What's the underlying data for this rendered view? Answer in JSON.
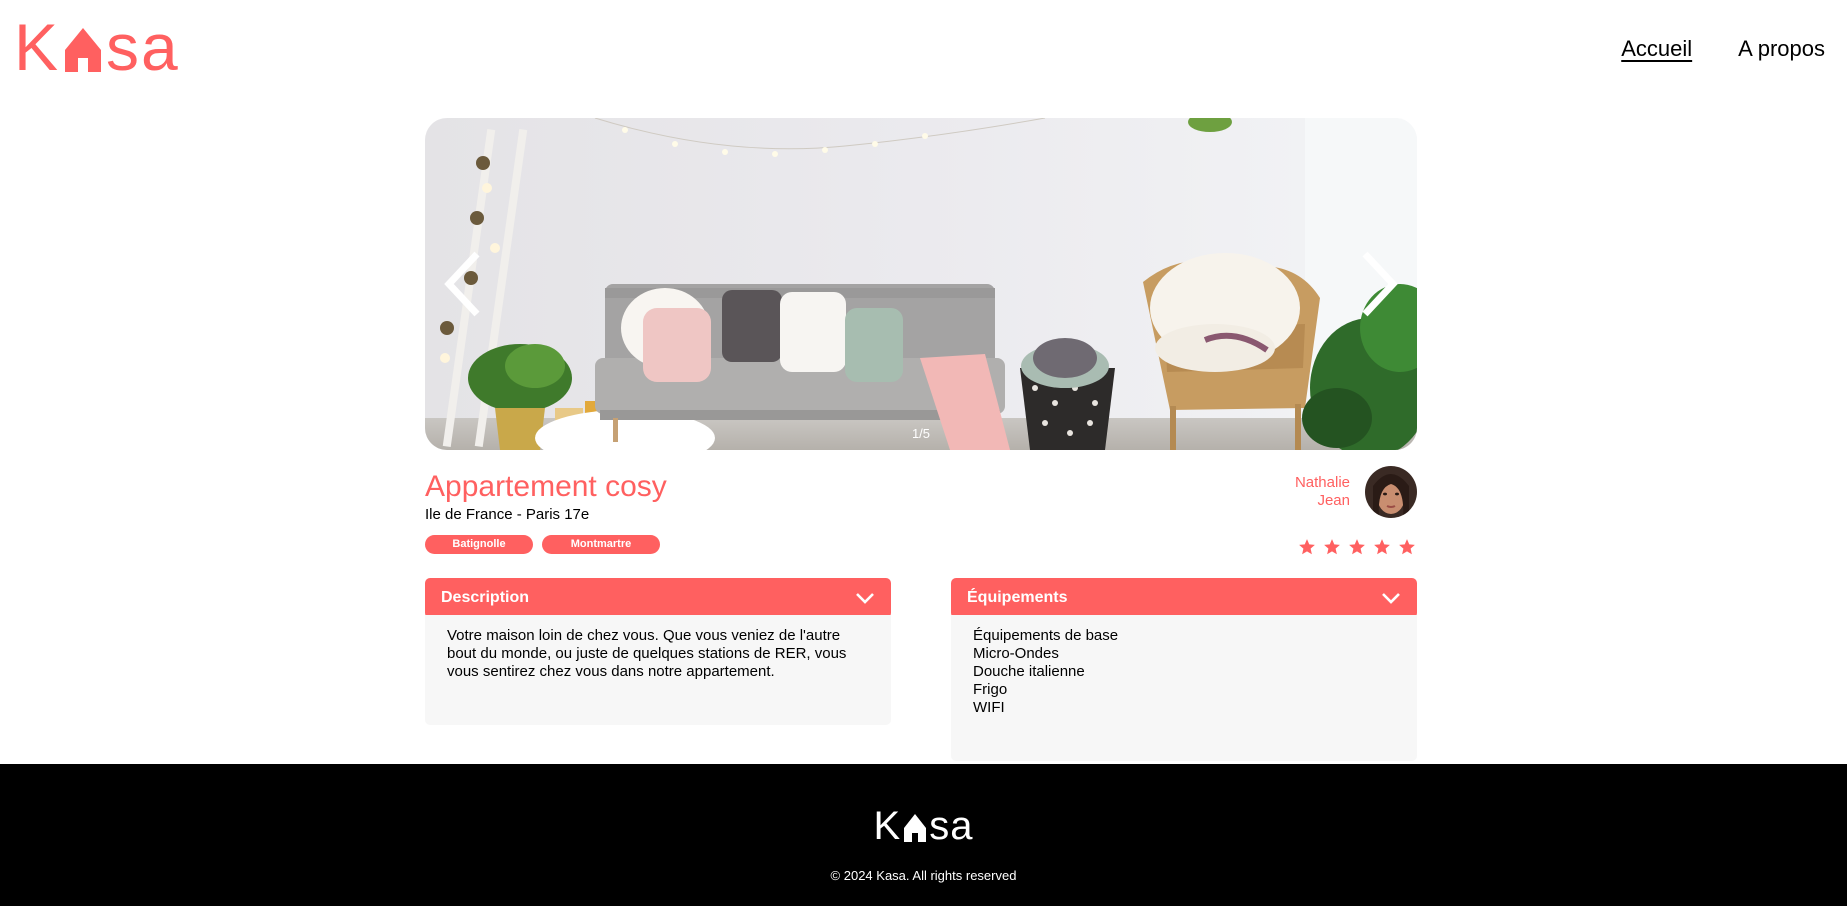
{
  "header": {
    "logo_letters": [
      "K",
      "sa"
    ],
    "logo_text": "Kasa",
    "nav": [
      {
        "label": "Accueil",
        "active": true
      },
      {
        "label": "A propos",
        "active": false
      }
    ]
  },
  "carousel": {
    "counter": "1/5",
    "prev_icon": "chevron-left-icon",
    "next_icon": "chevron-right-icon"
  },
  "listing": {
    "title": "Appartement cosy",
    "location": "Ile de France - Paris 17e",
    "tags": [
      "Batignolle",
      "Montmartre"
    ],
    "host": {
      "first_name": "Nathalie",
      "last_name": "Jean"
    },
    "rating": 5,
    "rating_max": 5
  },
  "description": {
    "label": "Description",
    "text": "Votre maison loin de chez vous. Que vous veniez de l'autre bout du monde, ou juste de quelques stations de RER, vous vous sentirez chez vous dans notre appartement."
  },
  "equipments": {
    "label": "Équipements",
    "items": [
      "Équipements de base",
      "Micro-Ondes",
      "Douche italienne",
      "Frigo",
      "WIFI"
    ]
  },
  "footer": {
    "copyright": "© 2024 Kasa. All rights reserved"
  },
  "colors": {
    "accent": "#FF6060",
    "background": "#FFFFFF",
    "collapse_body": "#F7F7F7",
    "footer": "#000000"
  }
}
